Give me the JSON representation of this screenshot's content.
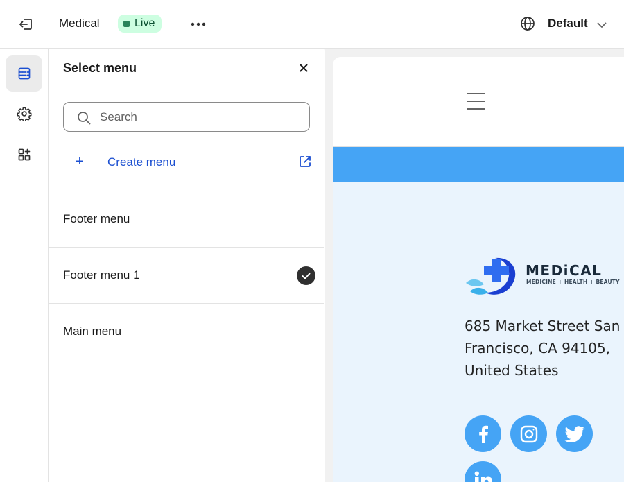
{
  "topbar": {
    "store_name": "Medical",
    "status_badge": "Live",
    "language_selector": "Default",
    "colors": {
      "badge_bg": "#cdfee1",
      "badge_text": "#0c5132",
      "badge_dot": "#29845a"
    }
  },
  "rail": {
    "items": [
      {
        "icon": "sections-icon",
        "active": true
      },
      {
        "icon": "gear-icon",
        "active": false
      },
      {
        "icon": "apps-add-icon",
        "active": false
      }
    ]
  },
  "panel": {
    "title": "Select menu",
    "search": {
      "placeholder": "Search",
      "value": ""
    },
    "create_label": "Create menu",
    "menus": [
      {
        "label": "Footer menu",
        "selected": false
      },
      {
        "label": "Footer menu 1",
        "selected": true
      },
      {
        "label": "Main menu",
        "selected": false
      }
    ]
  },
  "preview": {
    "logo_name": "MEDiCAL",
    "logo_tagline": "MEDICINE + HEALTH + BEAUTY",
    "address_lines": [
      "685 Market Street San",
      "Francisco, CA 94105,",
      "United States"
    ],
    "social": [
      "facebook-icon",
      "instagram-icon",
      "twitter-icon",
      "linkedin-icon"
    ],
    "colors": {
      "accent": "#45a4f5",
      "footer_bg": "#eaf4fd",
      "link": "#1b4fd1"
    }
  }
}
